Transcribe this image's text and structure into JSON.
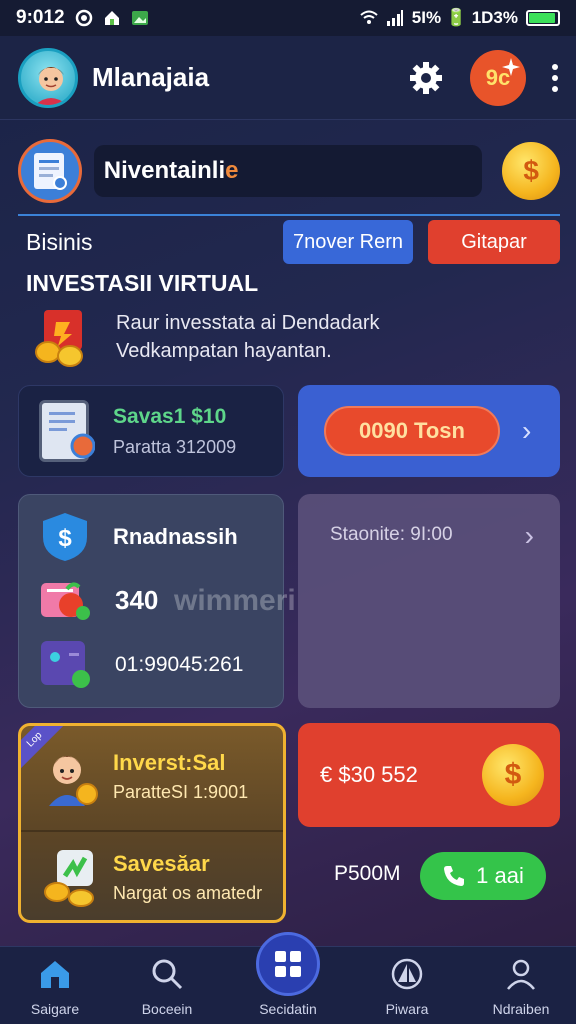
{
  "status_bar": {
    "time": "9:012",
    "battery_text": "5I% 🔋 1D3%"
  },
  "header": {
    "title": "Mlanajaia",
    "badge_text": "9c"
  },
  "profile": {
    "name_main": "Niventainli",
    "name_accent": "e",
    "coin_symbol": "$"
  },
  "tabs": {
    "section_label": "Bisinis",
    "tab1": "7nover Rern",
    "tab2": "Gitapar"
  },
  "investment": {
    "title": "INVESTASII VIRTUAL",
    "desc_line1": "Raur invesstata ai Dendadark",
    "desc_line2": "Vedkampatan hayantan."
  },
  "savings_card": {
    "title": "Savas1 $10",
    "subtitle": "Paratta 312009"
  },
  "blue_card": {
    "pill": "0090 Tosn"
  },
  "grey_card": {
    "row1": "Rnadnassih",
    "row2": "340",
    "row3": "01:99045:261"
  },
  "purple_card": {
    "line": "Staonite: 9I:00"
  },
  "watermark": "wimmeri",
  "gold_card": {
    "tag": "Lop",
    "row1_title": "Inverst:Sal",
    "row1_sub": "ParatteSI 1:9001",
    "row2_title": "Savesăar",
    "row2_sub": "Nargat os amatedr"
  },
  "red_card": {
    "amount": "€ $30 552",
    "coin_symbol": "$"
  },
  "call": {
    "label_left": "P500M",
    "button": "1 aai"
  },
  "nav": {
    "items": [
      {
        "label": "Saigare",
        "icon": "home-icon"
      },
      {
        "label": "Boceein",
        "icon": "search-icon"
      },
      {
        "label": "Secidatin",
        "icon": "grid-icon"
      },
      {
        "label": "Piwara",
        "icon": "sail-icon"
      },
      {
        "label": "Ndraiben",
        "icon": "user-icon"
      }
    ]
  },
  "colors": {
    "accent_blue": "#3868d8",
    "accent_red": "#e0402e",
    "accent_green": "#34c44a",
    "gold": "#f0b230"
  }
}
